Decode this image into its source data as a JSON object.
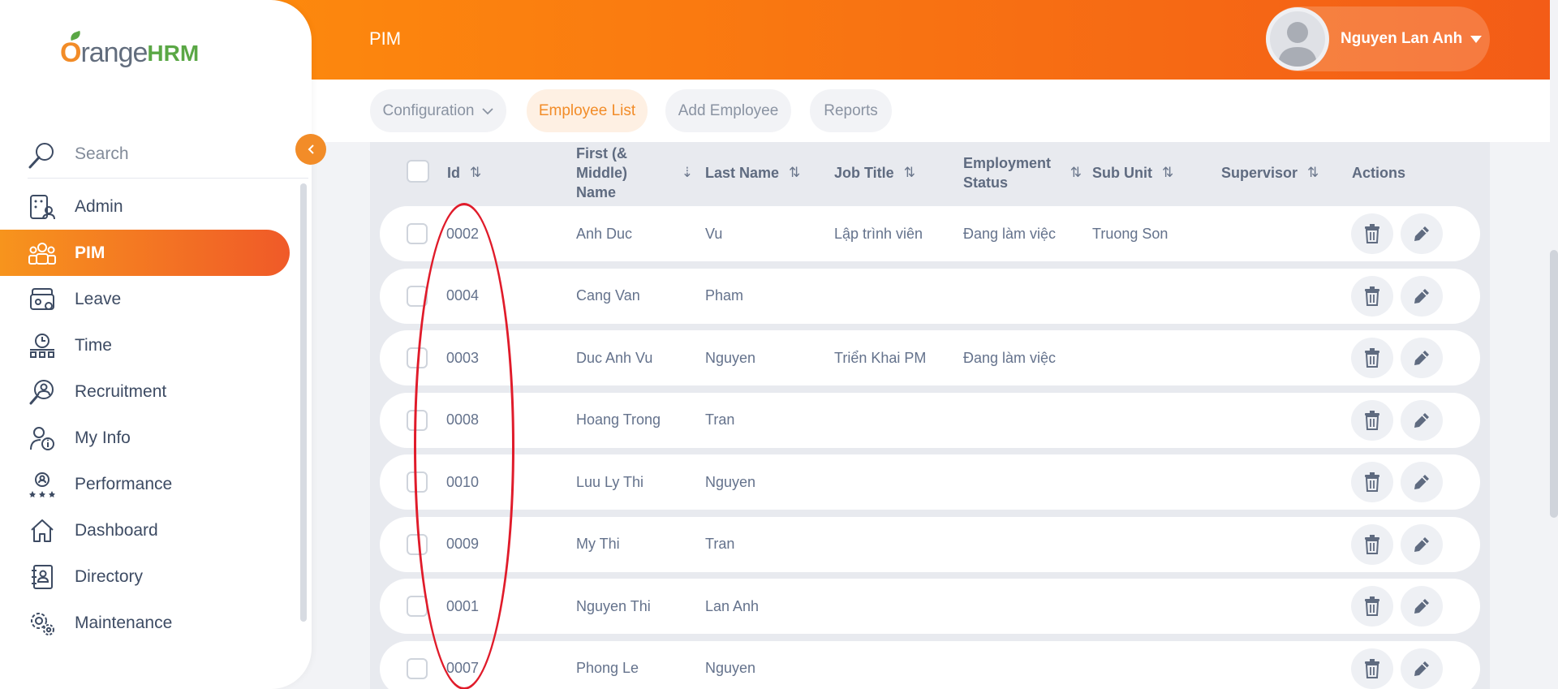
{
  "topbar": {
    "module_title": "PIM",
    "user_name": "Nguyen Lan Anh"
  },
  "sidebar": {
    "logo_prefix": "O",
    "logo_middle": "range",
    "logo_suffix": "HRM",
    "search_label": "Search",
    "items": [
      {
        "label": "Admin",
        "icon": "admin-icon",
        "active": false
      },
      {
        "label": "PIM",
        "icon": "pim-icon",
        "active": true
      },
      {
        "label": "Leave",
        "icon": "leave-icon",
        "active": false
      },
      {
        "label": "Time",
        "icon": "time-icon",
        "active": false
      },
      {
        "label": "Recruitment",
        "icon": "recruitment-icon",
        "active": false
      },
      {
        "label": "My Info",
        "icon": "my-info-icon",
        "active": false
      },
      {
        "label": "Performance",
        "icon": "performance-icon",
        "active": false
      },
      {
        "label": "Dashboard",
        "icon": "dashboard-icon",
        "active": false
      },
      {
        "label": "Directory",
        "icon": "directory-icon",
        "active": false
      },
      {
        "label": "Maintenance",
        "icon": "maintenance-icon",
        "active": false
      }
    ]
  },
  "subnav": {
    "tabs": [
      {
        "label": "Configuration",
        "active": false
      },
      {
        "label": "Employee List",
        "active": true
      },
      {
        "label": "Add Employee",
        "active": false
      },
      {
        "label": "Reports",
        "active": false
      }
    ]
  },
  "table": {
    "headers": {
      "id": "Id",
      "first_line1": "First (&",
      "first_line2": "Middle)",
      "first_line3": "Name",
      "last_name": "Last Name",
      "job_title": "Job Title",
      "emp_line1": "Employment",
      "emp_line2": "Status",
      "sub_unit": "Sub Unit",
      "supervisor": "Supervisor",
      "actions": "Actions"
    },
    "rows": [
      {
        "id": "0002",
        "first": "Anh Duc",
        "last": "Vu",
        "job": "Lập trình viên",
        "status": "Đang làm việc",
        "sub_unit": "Truong Son",
        "supervisor": ""
      },
      {
        "id": "0004",
        "first": "Cang Van",
        "last": "Pham",
        "job": "",
        "status": "",
        "sub_unit": "",
        "supervisor": ""
      },
      {
        "id": "0003",
        "first": "Duc Anh Vu",
        "last": "Nguyen",
        "job": "Triển Khai PM",
        "status": "Đang làm việc",
        "sub_unit": "",
        "supervisor": ""
      },
      {
        "id": "0008",
        "first": "Hoang Trong",
        "last": "Tran",
        "job": "",
        "status": "",
        "sub_unit": "",
        "supervisor": ""
      },
      {
        "id": "0010",
        "first": "Luu Ly Thi",
        "last": "Nguyen",
        "job": "",
        "status": "",
        "sub_unit": "",
        "supervisor": ""
      },
      {
        "id": "0009",
        "first": "My Thi",
        "last": "Tran",
        "job": "",
        "status": "",
        "sub_unit": "",
        "supervisor": ""
      },
      {
        "id": "0001",
        "first": "Nguyen Thi",
        "last": "Lan Anh",
        "job": "",
        "status": "",
        "sub_unit": "",
        "supervisor": ""
      },
      {
        "id": "0007",
        "first": "Phong Le",
        "last": "Nguyen",
        "job": "",
        "status": "",
        "sub_unit": "",
        "supervisor": ""
      }
    ]
  },
  "colors": {
    "accent": "#f28c28",
    "accent_dark": "#f05a28",
    "annotation": "#e01b2a"
  }
}
